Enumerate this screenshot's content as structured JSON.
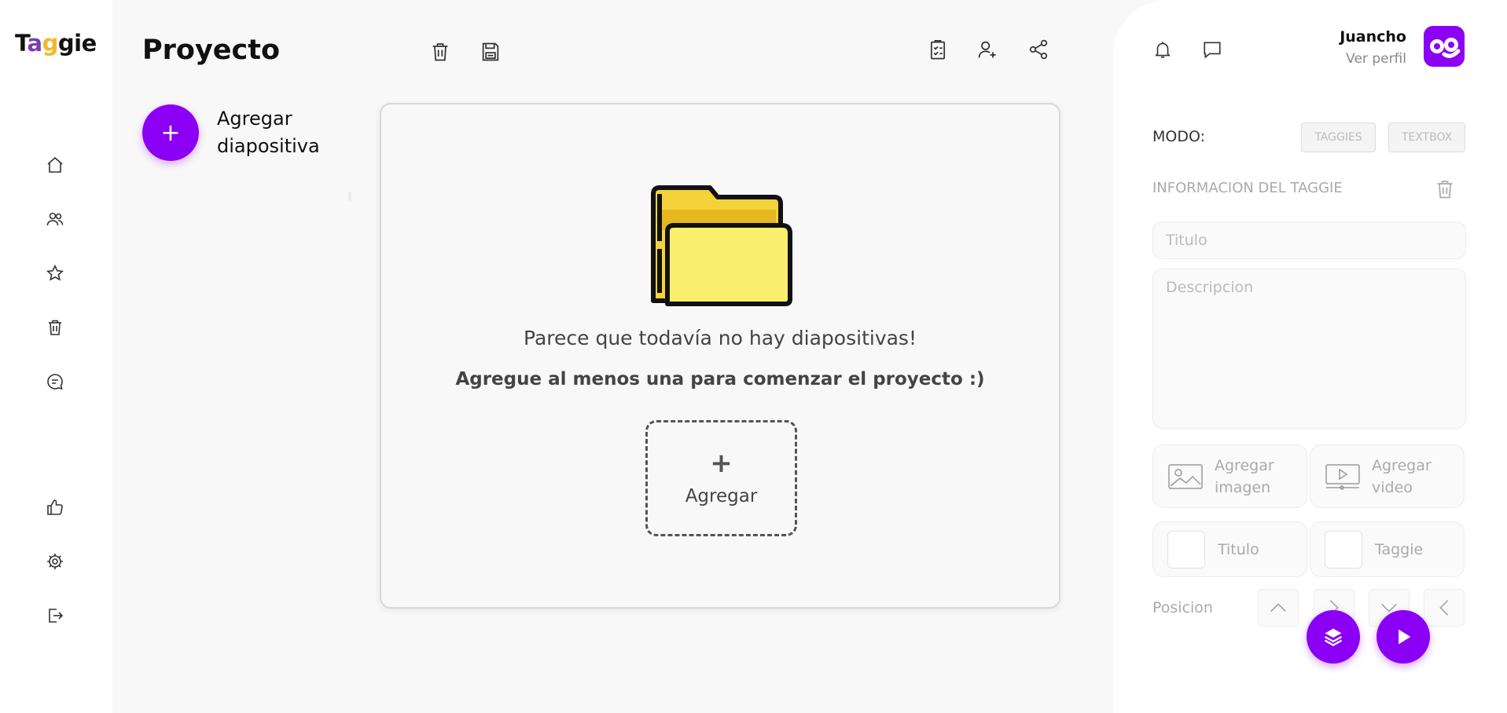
{
  "app": {
    "logo_text": "Taggie",
    "brand_color": "#8b00f5"
  },
  "sidebar": {
    "items": [
      {
        "icon": "home-icon"
      },
      {
        "icon": "users-icon"
      },
      {
        "icon": "star-icon"
      },
      {
        "icon": "trash-icon"
      },
      {
        "icon": "chat-icon"
      },
      {
        "icon": "thumbs-up-icon"
      },
      {
        "icon": "gear-icon"
      },
      {
        "icon": "logout-icon"
      }
    ]
  },
  "header": {
    "title": "Proyecto",
    "toolbar_icons": [
      "trash-icon",
      "save-icon",
      "clipboard-check-icon",
      "add-user-icon",
      "share-icon"
    ]
  },
  "slides": {
    "add_button_symbol": "+",
    "add_label": "Agregar diapositiva"
  },
  "main": {
    "empty_message": "Parece que todavía no hay diapositivas!",
    "empty_sub": "Agregue al menos una para comenzar el proyecto :)",
    "add_symbol": "+",
    "add_label": "Agregar"
  },
  "user": {
    "name": "Juancho",
    "view_profile": "Ver perfil"
  },
  "panel": {
    "mode_label": "MODO:",
    "mode_options": [
      "TAGGIES",
      "TEXTBOX"
    ],
    "info_label": "INFORMACION DEL TAGGIE",
    "title_placeholder": "Titulo",
    "description_placeholder": "Descripcion",
    "add_image": "Agregar imagen",
    "add_video": "Agregar video",
    "check_title": "Titulo",
    "check_taggie": "Taggie",
    "position_label": "Posicion"
  }
}
